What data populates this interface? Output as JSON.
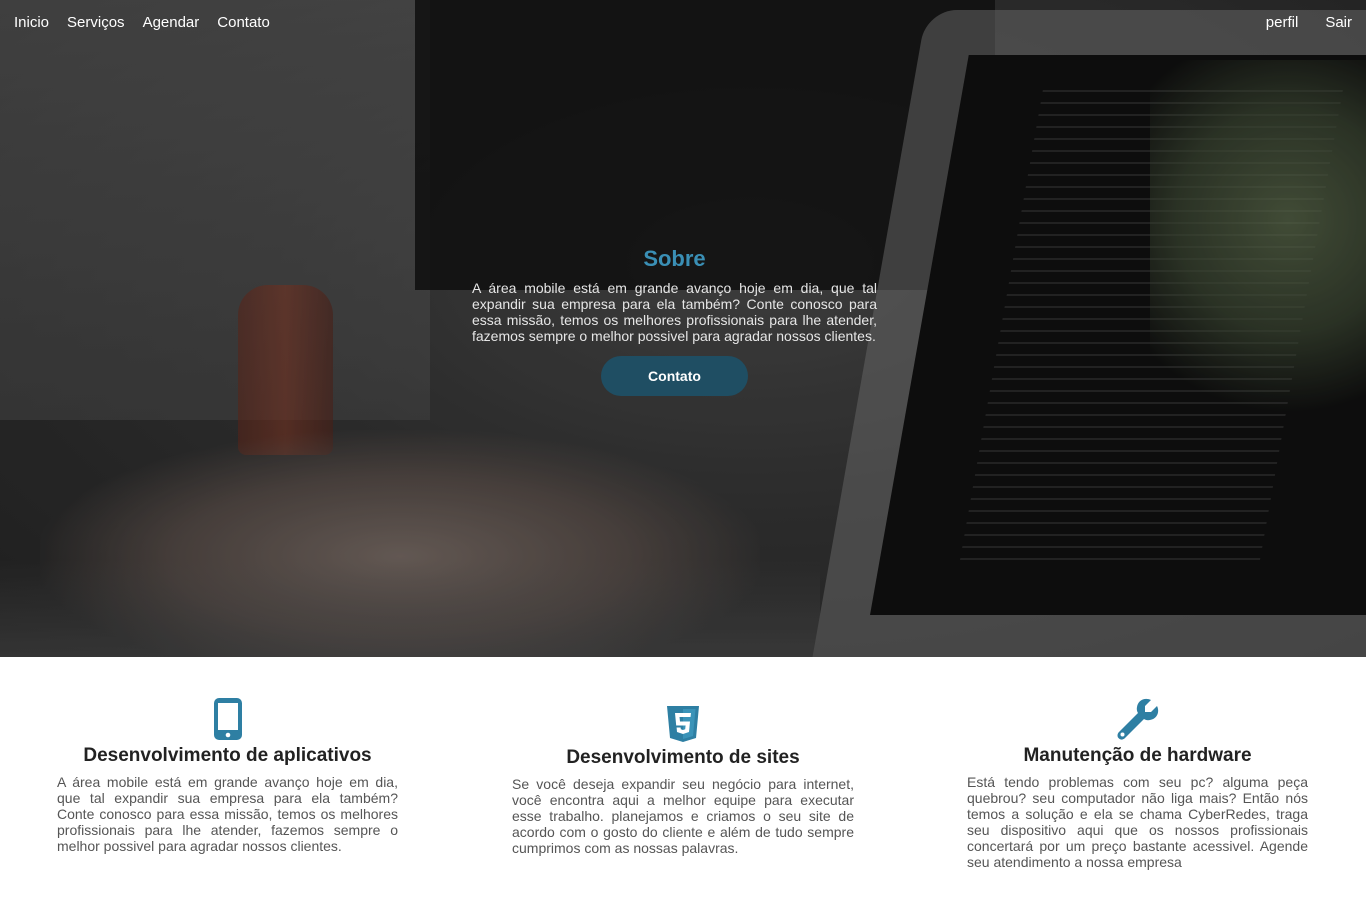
{
  "nav": {
    "left": [
      "Inicio",
      "Serviços",
      "Agendar",
      "Contato"
    ],
    "profile": "perfil",
    "logout": "Sair"
  },
  "about": {
    "title": "Sobre",
    "text": "A área mobile está em grande avanço hoje em dia, que tal expandir sua empresa para ela também? Conte conosco para essa missão, temos os melhores profissionais para lhe atender, fazemos sempre o melhor possivel para agradar nossos clientes.",
    "button": "Contato"
  },
  "services": [
    {
      "icon": "mobile-phone-icon",
      "title": "Desenvolvimento de aplicativos",
      "text": "A área mobile está em grande avanço hoje em dia, que tal expandir sua empresa para ela também? Conte conosco para essa missão, temos os melhores profissionais para lhe atender, fazemos sempre o melhor possivel para agradar nossos clientes."
    },
    {
      "icon": "html5-icon",
      "title": "Desenvolvimento de sites",
      "text": "Se você deseja expandir seu negócio para internet, você encontra aqui a melhor equipe para executar esse trabalho. planejamos e criamos o seu site de acordo com o gosto do cliente e além de tudo sempre cumprimos com as nossas palavras."
    },
    {
      "icon": "wrench-icon",
      "title": "Manutenção de hardware",
      "text": "Está tendo problemas com seu pc? alguma peça quebrou? seu computador não liga mais? Então nós temos a solução e ela se chama CyberRedes, traga seu dispositivo aqui que os nossos profissionais concertará por um preço bastante acessivel. Agende seu atendimento a nossa empresa"
    }
  ],
  "colors": {
    "accent": "#3a8fb5",
    "button": "#1f4e63",
    "icon": "#2e7fa3"
  }
}
